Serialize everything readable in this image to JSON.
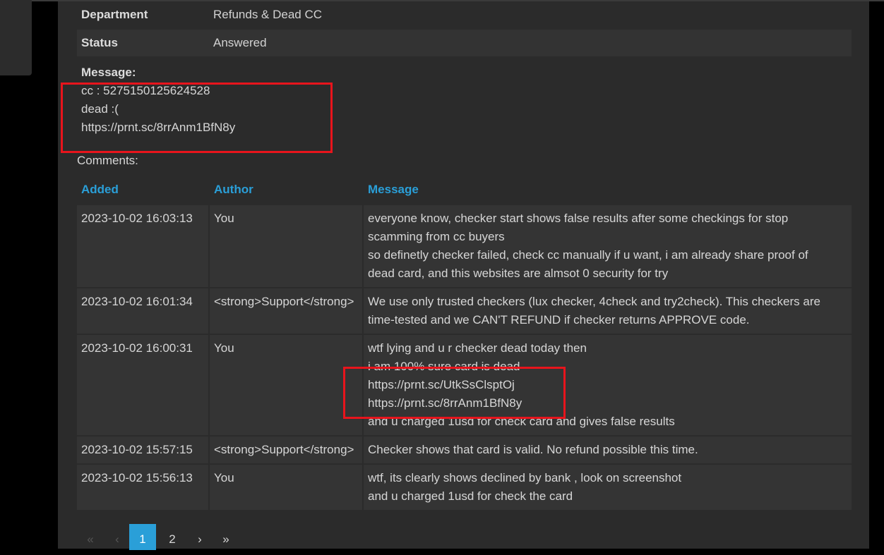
{
  "ticket": {
    "department_label": "Department",
    "department_value": "Refunds & Dead CC",
    "status_label": "Status",
    "status_value": "Answered",
    "message_label": "Message:",
    "message_lines": [
      "cc : 5275150125624528",
      "dead :(",
      "https://prnt.sc/8rrAnm1BfN8y"
    ]
  },
  "comments": {
    "label": "Comments:",
    "headers": {
      "added": "Added",
      "author": "Author",
      "message": "Message"
    },
    "rows": [
      {
        "added": "2023-10-02 16:03:13",
        "author": "You",
        "message_lines": [
          "everyone know, checker start shows false results after some checkings for stop",
          "scamming from cc buyers",
          "so definetly checker failed, check cc manually if u want, i am already share proof of",
          "dead card, and this websites are almsot 0 security for try"
        ]
      },
      {
        "added": "2023-10-02 16:01:34",
        "author": "<strong>Support</strong>",
        "message_lines": [
          "We use only trusted checkers (lux checker, 4check and try2check). This checkers are",
          "time-tested and we CAN'T REFUND if checker returns APPROVE code."
        ]
      },
      {
        "added": "2023-10-02 16:00:31",
        "author": "You",
        "message_lines": [
          "wtf lying and u r checker dead today then",
          "i am 100% sure card is dead",
          "https://prnt.sc/UtkSsClsptOj",
          "https://prnt.sc/8rrAnm1BfN8y",
          "and u charged 1usd for check card and gives false results"
        ]
      },
      {
        "added": "2023-10-02 15:57:15",
        "author": "<strong>Support</strong>",
        "message_lines": [
          "Checker shows that card is valid. No refund possible this time."
        ]
      },
      {
        "added": "2023-10-02 15:56:13",
        "author": "You",
        "message_lines": [
          "wtf, its clearly shows declined by bank , look on screenshot",
          "and u charged 1usd for check the card"
        ]
      }
    ]
  },
  "pagination": {
    "first": "«",
    "prev": "‹",
    "page1": "1",
    "page2": "2",
    "next": "›",
    "last": "»"
  },
  "colors": {
    "accent": "#2a9fd8",
    "highlight_box": "#e8141c",
    "panel": "#2b2b2b",
    "row": "#343434"
  }
}
